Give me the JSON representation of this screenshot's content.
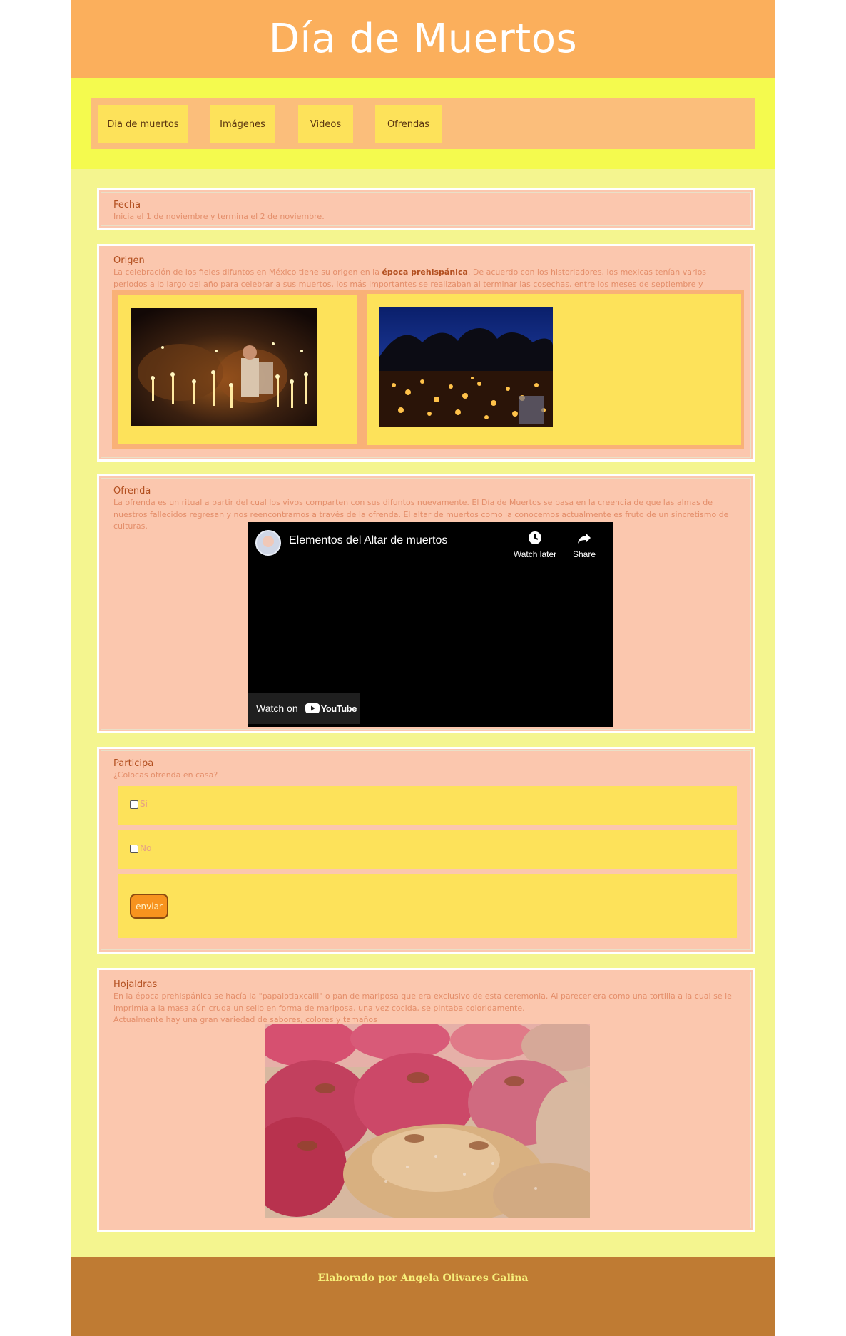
{
  "header": {
    "title": "Día de Muertos"
  },
  "nav": {
    "items": [
      "Dia de muertos",
      "Imágenes",
      "Videos",
      "Ofrendas"
    ]
  },
  "fecha": {
    "title": "Fecha",
    "text": "Inicia el 1 de noviembre y termina el 2 de noviembre."
  },
  "origen": {
    "title": "Origen",
    "text_before": "La celebración de los fieles difuntos en México tiene su origen en la ",
    "highlight": "época prehispánica",
    "text_after": ". De acuerdo con los historiadores, los mexicas tenían varios periodos a lo largo del año para celebrar a sus muertos, los más importantes se realizaban al terminar las cosechas, entre los meses de septiembre y noviembre."
  },
  "ofrenda": {
    "title": "Ofrenda",
    "text": "La ofrenda es un ritual a partir del cual los vivos comparten con sus difuntos nuevamente. El Día de Muertos se basa en la creencia de que las almas de nuestros fallecidos regresan y nos reencontramos a través de la ofrenda. El altar de muertos como la conocemos actualmente es fruto de un sincretismo de culturas.",
    "video": {
      "title": "Elementos del Altar de muertos",
      "watch_later": "Watch later",
      "share": "Share",
      "watch_on": "Watch on",
      "brand": "YouTube"
    }
  },
  "participa": {
    "title": "Participa",
    "question": "¿Colocas ofrenda en casa?",
    "options": [
      "Si",
      "No"
    ],
    "submit": "enviar"
  },
  "hojaldras": {
    "title": "Hojaldras",
    "text1": "En la época prehispánica se hacía la \"papalotlaxcalli\" o pan de mariposa que era exclusivo de esta ceremonia. Al parecer era como una tortilla a la cual se le imprimía a la masa aún cruda un sello en forma de mariposa, una vez cocida, se pintaba coloridamente.",
    "text2": "Actualmente hay una gran variedad de sabores, colores y tamaños"
  },
  "footer": {
    "text": "Elaborado por Angela Olivares Galina"
  },
  "colors": {
    "header_bg": "#fbaf5c",
    "nav_band": "#f4fa4e",
    "page_bg": "#f4f58f",
    "section_bg": "#fbc7ae",
    "box_yellow": "#fde25a",
    "title_brown": "#b24e1e",
    "footer_bg": "#bf7b33",
    "button_orange": "#f7931e"
  }
}
